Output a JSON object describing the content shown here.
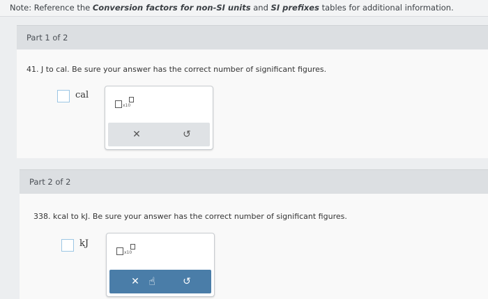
{
  "note": {
    "prefix": "Note: Reference the ",
    "bold1": "Conversion factors for non-SI units",
    "mid": " and ",
    "bold2": "SI prefixes",
    "suffix": " tables for additional information."
  },
  "parts": [
    {
      "header": "Part 1 of 2",
      "question": "41. J to cal. Be sure your answer has the correct number of significant figures.",
      "unit": "cal"
    },
    {
      "header": "Part 2 of 2",
      "question": "338. kcal to kJ. Be sure your answer has the correct number of significant figures.",
      "unit": "kJ"
    }
  ],
  "tools": {
    "x10_label": "x10",
    "clear_glyph": "✕",
    "undo_glyph": "↺",
    "cursor_glyph": "☝"
  },
  "colors": {
    "accent": "#4a7da8",
    "answer_border": "#9cc6e4"
  }
}
